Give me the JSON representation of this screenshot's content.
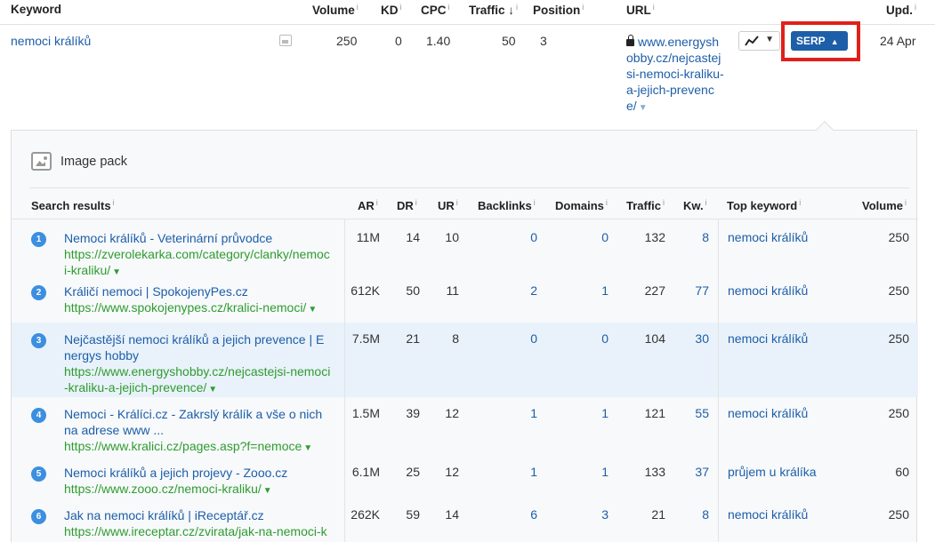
{
  "header": {
    "keyword": "Keyword",
    "volume": "Volume",
    "kd": "KD",
    "cpc": "CPC",
    "traffic": "Traffic",
    "traffic_sort": "↓",
    "position": "Position",
    "url": "URL",
    "upd": "Upd.",
    "info": "i"
  },
  "keyword_row": {
    "keyword": "nemoci králíků",
    "volume": "250",
    "kd": "0",
    "cpc": "1.40",
    "traffic": "50",
    "position": "3",
    "url": "www.energyshobby.cz/nejcastejsi-nemoci-kraliku-a-jejich-prevence/",
    "serp_label": "SERP",
    "updated": "24 Apr"
  },
  "panel": {
    "feature": "Image pack",
    "columns": {
      "results": "Search results",
      "ar": "AR",
      "dr": "DR",
      "ur": "UR",
      "backlinks": "Backlinks",
      "domains": "Domains",
      "traffic": "Traffic",
      "kw": "Kw.",
      "top_keyword": "Top keyword",
      "volume": "Volume"
    },
    "rows": [
      {
        "num": "1",
        "title": "Nemoci králíků - Veterinární průvodce",
        "url": "https://zverolekarka.com/category/clanky/nemoci-kraliku/",
        "ar": "11M",
        "dr": "14",
        "ur": "10",
        "backlinks": "0",
        "domains": "0",
        "traffic": "132",
        "kw": "8",
        "top_keyword": "nemoci králíků",
        "volume": "250"
      },
      {
        "num": "2",
        "title": "Králičí nemoci | SpokojenyPes.cz",
        "url": "https://www.spokojenypes.cz/kralici-nemoci/",
        "ar": "612K",
        "dr": "50",
        "ur": "11",
        "backlinks": "2",
        "domains": "1",
        "traffic": "227",
        "kw": "77",
        "top_keyword": "nemoci králíků",
        "volume": "250"
      },
      {
        "num": "3",
        "title": "Nejčastější nemoci králíků a jejich prevence | Energys hobby",
        "url": "https://www.energyshobby.cz/nejcastejsi-nemoci-kraliku-a-jejich-prevence/",
        "ar": "7.5M",
        "dr": "21",
        "ur": "8",
        "backlinks": "0",
        "domains": "0",
        "traffic": "104",
        "kw": "30",
        "top_keyword": "nemoci králíků",
        "volume": "250"
      },
      {
        "num": "4",
        "title": "Nemoci - Králíci.cz - Zakrslý králík a vše o nich na adrese www ...",
        "url": "https://www.kralici.cz/pages.asp?f=nemoce",
        "ar": "1.5M",
        "dr": "39",
        "ur": "12",
        "backlinks": "1",
        "domains": "1",
        "traffic": "121",
        "kw": "55",
        "top_keyword": "nemoci králíků",
        "volume": "250"
      },
      {
        "num": "5",
        "title": "Nemoci králíků a jejich projevy - Zooo.cz",
        "url": "https://www.zooo.cz/nemoci-kraliku/",
        "ar": "6.1M",
        "dr": "25",
        "ur": "12",
        "backlinks": "1",
        "domains": "1",
        "traffic": "133",
        "kw": "37",
        "top_keyword": "průjem u králíka",
        "volume": "60"
      },
      {
        "num": "6",
        "title": "Jak na nemoci králíků | iReceptář.cz",
        "url": "https://www.ireceptar.cz/zvirata/jak-na-nemoci-kraliku.html",
        "ar": "262K",
        "dr": "59",
        "ur": "14",
        "backlinks": "6",
        "domains": "3",
        "traffic": "21",
        "kw": "8",
        "top_keyword": "nemoci králíků",
        "volume": "250"
      }
    ]
  }
}
